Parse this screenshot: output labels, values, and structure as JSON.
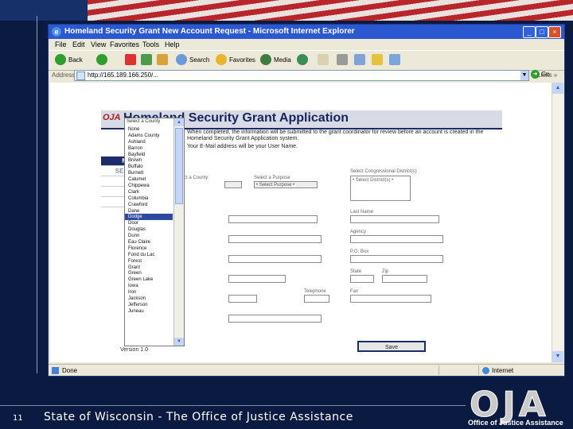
{
  "slide": {
    "number": "11",
    "footer": "State of Wisconsin - The Office of Justice Assistance",
    "logo_letters": "OJA",
    "logo_caption": "Office of Justice Assistance"
  },
  "window": {
    "title": "Homeland Security Grant New Account Request - Microsoft Internet Explorer",
    "menu": [
      "File",
      "Edit",
      "View",
      "Favorites",
      "Tools",
      "Help"
    ],
    "toolbar": {
      "back": "Back",
      "search": "Search",
      "favorites": "Favorites",
      "media": "Media"
    },
    "address_label": "Address",
    "address": "http://165.189.166.250/...",
    "go": "Go",
    "links": "Links »",
    "status": "Done",
    "zone": "Internet"
  },
  "app": {
    "logo": "OJA",
    "title": "Homeland Security Grant Application",
    "nav": [
      "MY ACCOUNT",
      "SELECT GRANT",
      "EQUIPMENT",
      "COMMITTEE",
      "SUMMARY"
    ],
    "version": "Version 1.0",
    "bullets": [
      "When completed, the information will be submitted to the grant coordinator for review before an account is created in the Homeland Security Grant Application system.",
      "Your E-Mail address will be your User Name."
    ],
    "labels": {
      "county": "Select a County",
      "purpose": "Select a Purpose",
      "purpose_value": "• Select Purpose •",
      "congressional": "Select Congressional District(s)",
      "congressional_value": "• Select District(s) •",
      "last_name": "Last Name",
      "agency": "Agency",
      "po_box": "P.O. Box",
      "state": "State",
      "zip": "Zip",
      "telephone": "Telephone",
      "fax": "Fax"
    },
    "save": "Save",
    "counties": [
      "None",
      "Adams County",
      "Ashland",
      "Barron",
      "Bayfield",
      "Brown",
      "Buffalo",
      "Burnett",
      "Calumet",
      "Chippewa",
      "Clark",
      "Columbia",
      "Crawford",
      "Dane",
      "Dodge",
      "Door",
      "Douglas",
      "Dunn",
      "Eau Claire",
      "Florence",
      "Fond du Lac",
      "Forest",
      "Grant",
      "Green",
      "Green Lake",
      "Iowa",
      "Iron",
      "Jackson",
      "Jefferson",
      "Juneau"
    ],
    "selected_county_index": 14
  }
}
